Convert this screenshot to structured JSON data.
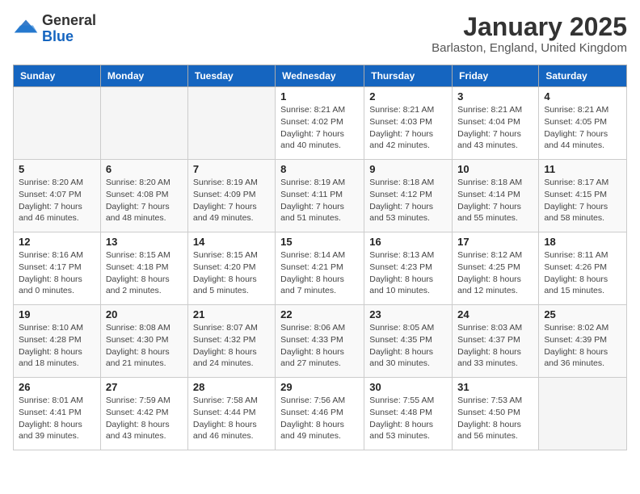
{
  "header": {
    "logo_general": "General",
    "logo_blue": "Blue",
    "month": "January 2025",
    "location": "Barlaston, England, United Kingdom"
  },
  "days_of_week": [
    "Sunday",
    "Monday",
    "Tuesday",
    "Wednesday",
    "Thursday",
    "Friday",
    "Saturday"
  ],
  "weeks": [
    [
      {
        "day": "",
        "info": ""
      },
      {
        "day": "",
        "info": ""
      },
      {
        "day": "",
        "info": ""
      },
      {
        "day": "1",
        "info": "Sunrise: 8:21 AM\nSunset: 4:02 PM\nDaylight: 7 hours\nand 40 minutes."
      },
      {
        "day": "2",
        "info": "Sunrise: 8:21 AM\nSunset: 4:03 PM\nDaylight: 7 hours\nand 42 minutes."
      },
      {
        "day": "3",
        "info": "Sunrise: 8:21 AM\nSunset: 4:04 PM\nDaylight: 7 hours\nand 43 minutes."
      },
      {
        "day": "4",
        "info": "Sunrise: 8:21 AM\nSunset: 4:05 PM\nDaylight: 7 hours\nand 44 minutes."
      }
    ],
    [
      {
        "day": "5",
        "info": "Sunrise: 8:20 AM\nSunset: 4:07 PM\nDaylight: 7 hours\nand 46 minutes."
      },
      {
        "day": "6",
        "info": "Sunrise: 8:20 AM\nSunset: 4:08 PM\nDaylight: 7 hours\nand 48 minutes."
      },
      {
        "day": "7",
        "info": "Sunrise: 8:19 AM\nSunset: 4:09 PM\nDaylight: 7 hours\nand 49 minutes."
      },
      {
        "day": "8",
        "info": "Sunrise: 8:19 AM\nSunset: 4:11 PM\nDaylight: 7 hours\nand 51 minutes."
      },
      {
        "day": "9",
        "info": "Sunrise: 8:18 AM\nSunset: 4:12 PM\nDaylight: 7 hours\nand 53 minutes."
      },
      {
        "day": "10",
        "info": "Sunrise: 8:18 AM\nSunset: 4:14 PM\nDaylight: 7 hours\nand 55 minutes."
      },
      {
        "day": "11",
        "info": "Sunrise: 8:17 AM\nSunset: 4:15 PM\nDaylight: 7 hours\nand 58 minutes."
      }
    ],
    [
      {
        "day": "12",
        "info": "Sunrise: 8:16 AM\nSunset: 4:17 PM\nDaylight: 8 hours\nand 0 minutes."
      },
      {
        "day": "13",
        "info": "Sunrise: 8:15 AM\nSunset: 4:18 PM\nDaylight: 8 hours\nand 2 minutes."
      },
      {
        "day": "14",
        "info": "Sunrise: 8:15 AM\nSunset: 4:20 PM\nDaylight: 8 hours\nand 5 minutes."
      },
      {
        "day": "15",
        "info": "Sunrise: 8:14 AM\nSunset: 4:21 PM\nDaylight: 8 hours\nand 7 minutes."
      },
      {
        "day": "16",
        "info": "Sunrise: 8:13 AM\nSunset: 4:23 PM\nDaylight: 8 hours\nand 10 minutes."
      },
      {
        "day": "17",
        "info": "Sunrise: 8:12 AM\nSunset: 4:25 PM\nDaylight: 8 hours\nand 12 minutes."
      },
      {
        "day": "18",
        "info": "Sunrise: 8:11 AM\nSunset: 4:26 PM\nDaylight: 8 hours\nand 15 minutes."
      }
    ],
    [
      {
        "day": "19",
        "info": "Sunrise: 8:10 AM\nSunset: 4:28 PM\nDaylight: 8 hours\nand 18 minutes."
      },
      {
        "day": "20",
        "info": "Sunrise: 8:08 AM\nSunset: 4:30 PM\nDaylight: 8 hours\nand 21 minutes."
      },
      {
        "day": "21",
        "info": "Sunrise: 8:07 AM\nSunset: 4:32 PM\nDaylight: 8 hours\nand 24 minutes."
      },
      {
        "day": "22",
        "info": "Sunrise: 8:06 AM\nSunset: 4:33 PM\nDaylight: 8 hours\nand 27 minutes."
      },
      {
        "day": "23",
        "info": "Sunrise: 8:05 AM\nSunset: 4:35 PM\nDaylight: 8 hours\nand 30 minutes."
      },
      {
        "day": "24",
        "info": "Sunrise: 8:03 AM\nSunset: 4:37 PM\nDaylight: 8 hours\nand 33 minutes."
      },
      {
        "day": "25",
        "info": "Sunrise: 8:02 AM\nSunset: 4:39 PM\nDaylight: 8 hours\nand 36 minutes."
      }
    ],
    [
      {
        "day": "26",
        "info": "Sunrise: 8:01 AM\nSunset: 4:41 PM\nDaylight: 8 hours\nand 39 minutes."
      },
      {
        "day": "27",
        "info": "Sunrise: 7:59 AM\nSunset: 4:42 PM\nDaylight: 8 hours\nand 43 minutes."
      },
      {
        "day": "28",
        "info": "Sunrise: 7:58 AM\nSunset: 4:44 PM\nDaylight: 8 hours\nand 46 minutes."
      },
      {
        "day": "29",
        "info": "Sunrise: 7:56 AM\nSunset: 4:46 PM\nDaylight: 8 hours\nand 49 minutes."
      },
      {
        "day": "30",
        "info": "Sunrise: 7:55 AM\nSunset: 4:48 PM\nDaylight: 8 hours\nand 53 minutes."
      },
      {
        "day": "31",
        "info": "Sunrise: 7:53 AM\nSunset: 4:50 PM\nDaylight: 8 hours\nand 56 minutes."
      },
      {
        "day": "",
        "info": ""
      }
    ]
  ]
}
